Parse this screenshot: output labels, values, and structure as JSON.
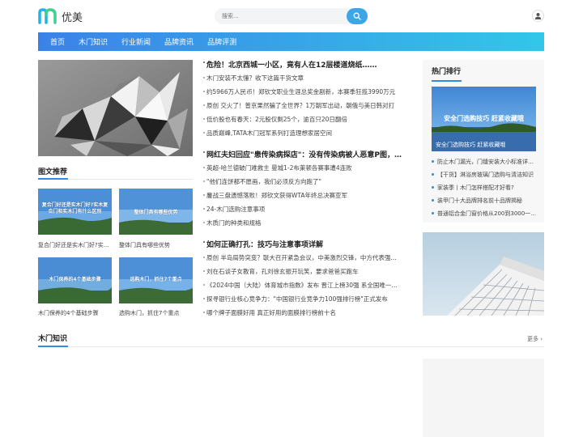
{
  "logo": {
    "text": "优美"
  },
  "search": {
    "placeholder": "搜索..."
  },
  "nav": [
    "首页",
    "木门知识",
    "行业新闻",
    "品牌资讯",
    "品牌评测"
  ],
  "sections": {
    "pic_rec": "图文推荐",
    "door_knowledge": "木门知识",
    "hot_rank": "热门排行",
    "more": "更多"
  },
  "thumbs": [
    {
      "caption": "复合门好还是实木门好?实木复合门和实木门有什么区别",
      "title": "复合门好还是实木门好?实..."
    },
    {
      "caption": "整体门具有哪些优势",
      "title": "整体门具有哪些优势"
    },
    {
      "caption": "木门保养的4个基础步骤",
      "title": "木门保养的4个基础步骤"
    },
    {
      "caption": "选购木门，抓住7个重点",
      "title": "选购木门，抓住7个重点"
    }
  ],
  "groups": [
    {
      "headline": "危险！北京西城一小区，竟有人在12层楼道烧纸……",
      "items": [
        "木门安装不太懂？收下这篇干货文章",
        "约5966万人民币！郑钦文职业生涯总奖金剧新，本赛季狂揽3990万元",
        "原创 交火了！普京果然骗了全世界？1万朝军出动，朝俄与美日韩对打",
        "低价股也有春天：2元股仅剩25个，逾百只20日翻倍",
        "品质巅峰,TATA木门冠军系列打造理想家居空间"
      ]
    },
    {
      "headline": "网红夫妇回应\"患传染病探店\"：没有传染病被人恶意P图，…",
      "items": [
        "英超-哈兰德破门难救主 曼城1-2布莱顿各赛事遭4连败",
        "\"他们连饼都不愿画，我们必须反方向跑了\"",
        "鏖战三盘遗憾落败！郑钦文获得WTA年终总决赛亚军",
        "24-木门选购注意事项",
        "木质门的种类和规格"
      ]
    },
    {
      "headline": "如何正确打孔：技巧与注意事项详解",
      "items": [
        "原创 半岛局势突变？联大召开紧急会议，中美激烈交锋，中方代表强…",
        "刘在石谈子女教育，孔刘徐玄振开玩笑，要求爸爸买跑车",
        "《2024中国（大陆）体育城市指数》发布 晋江上榜30强 系全国唯一…",
        "探寻银行业核心竞争力：\"中国银行业竞争力100强排行榜\"正式发布",
        "哪个牌子面膜好用 真正好用的面膜排行榜前十名"
      ]
    }
  ],
  "side": {
    "banner_caption": "安全门选购技巧 赶紧收藏哦",
    "banner_sub": "安全门选购技巧 赶紧收藏哦",
    "ranks": [
      "防止木门漏光，门缝安装大小标准详…",
      "【干货】淋浴房玻璃门选购与清洁知识",
      "家装季丨木门怎样搭配才好看?",
      "装甲门十大品牌排名前十品牌揭秘",
      "普通铝合金门窗价格从200到3000一…"
    ]
  }
}
